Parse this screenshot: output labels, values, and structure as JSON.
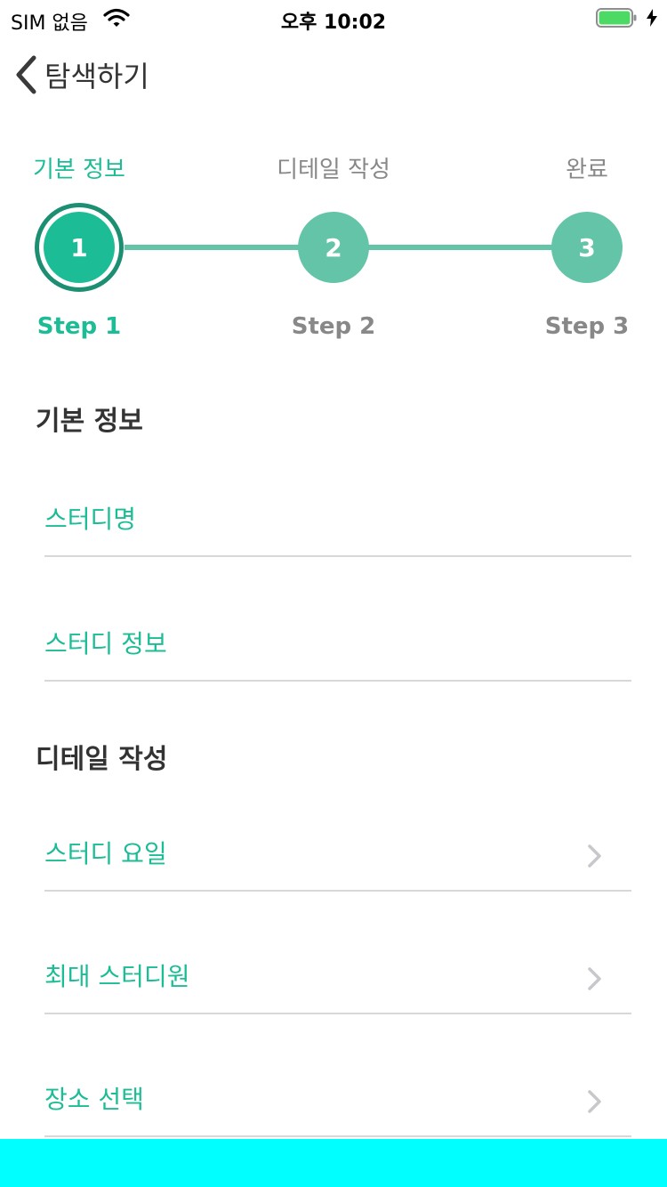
{
  "status_bar": {
    "carrier": "SIM 없음",
    "time": "오후 10:02",
    "battery_color": "#4cd964"
  },
  "nav": {
    "back_label": "탐색하기"
  },
  "stepper": {
    "accent_color": "#1cbd96",
    "inactive_color": "#63c4a7",
    "current_step": 1,
    "steps": [
      {
        "title": "기본 정보",
        "number": "1",
        "label": "Step 1"
      },
      {
        "title": "디테일 작성",
        "number": "2",
        "label": "Step 2"
      },
      {
        "title": "완료",
        "number": "3",
        "label": "Step 3"
      }
    ]
  },
  "basic_info": {
    "title": "기본 정보",
    "fields": [
      "스터디명",
      "스터디 정보"
    ]
  },
  "detail": {
    "title": "디테일 작성",
    "fields": [
      "스터디 요일",
      "최대 스터디원",
      "장소 선택"
    ]
  }
}
